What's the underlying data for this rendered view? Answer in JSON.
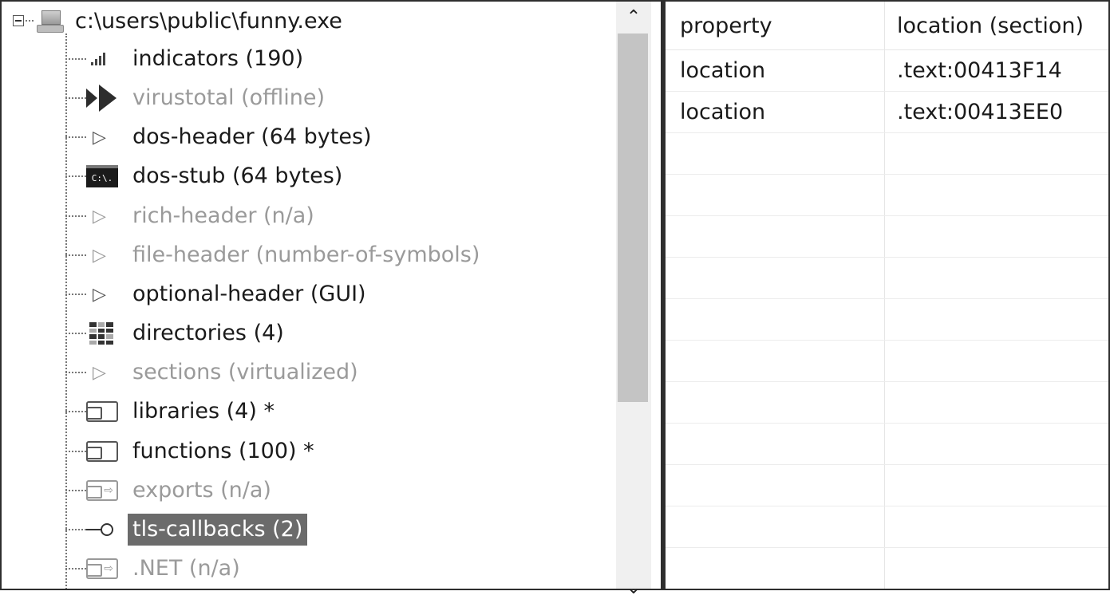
{
  "tree": {
    "root_label": "c:\\users\\public\\funny.exe",
    "nodes": [
      {
        "label": "indicators (190)",
        "icon": "bar-chart-icon",
        "state": "normal"
      },
      {
        "label": "virustotal (offline)",
        "icon": "virustotal-icon",
        "state": "dim"
      },
      {
        "label": "dos-header (64 bytes)",
        "icon": "chevron-right-icon",
        "state": "normal"
      },
      {
        "label": "dos-stub (64 bytes)",
        "icon": "console-icon",
        "console_text": "C:\\.",
        "state": "normal"
      },
      {
        "label": "rich-header (n/a)",
        "icon": "chevron-right-icon",
        "state": "dim"
      },
      {
        "label": "file-header (number-of-symbols)",
        "icon": "chevron-right-icon",
        "state": "dim"
      },
      {
        "label": "optional-header (GUI)",
        "icon": "chevron-right-icon",
        "state": "normal"
      },
      {
        "label": "directories (4)",
        "icon": "grid-icon",
        "state": "normal"
      },
      {
        "label": "sections (virtualized)",
        "icon": "chevron-right-icon",
        "state": "dim"
      },
      {
        "label": "libraries (4) *",
        "icon": "import-icon",
        "state": "normal"
      },
      {
        "label": "functions (100) *",
        "icon": "import-icon",
        "state": "normal"
      },
      {
        "label": "exports (n/a)",
        "icon": "export-icon",
        "state": "dim"
      },
      {
        "label": "tls-callbacks (2)",
        "icon": "key-icon",
        "state": "selected"
      },
      {
        "label": ".NET (n/a)",
        "icon": "export-icon",
        "state": "dim"
      }
    ]
  },
  "table": {
    "headers": [
      "property",
      "location (section)"
    ],
    "rows": [
      [
        "location",
        ".text:00413F14"
      ],
      [
        "location",
        ".text:00413EE0"
      ]
    ]
  },
  "colors": {
    "selection": "#6b6b6b",
    "dim_text": "#9a9a9a",
    "scroll_thumb": "#c4c4c4"
  }
}
